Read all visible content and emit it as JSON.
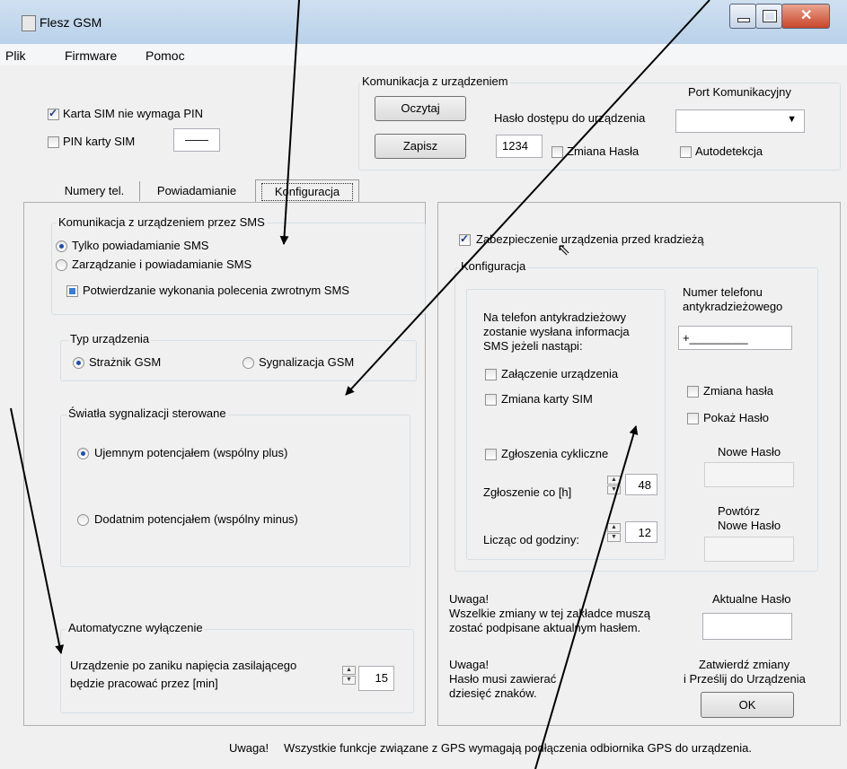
{
  "window": {
    "title": "Flesz GSM"
  },
  "menu": [
    "Plik",
    "Firmware",
    "Pomoc"
  ],
  "sim": {
    "no_pin_label": "Karta SIM nie wymaga PIN",
    "pin_label": "PIN karty SIM",
    "pin_value": "——"
  },
  "comm": {
    "title": "Komunikacja z urządzeniem",
    "read_btn": "Oczytaj",
    "save_btn": "Zapisz",
    "password_label": "Hasło dostępu do urządzenia",
    "password_value": "1234",
    "change_password_label": "Zmiana Hasła",
    "port_label": "Port Komunikacyjny",
    "autodetect_label": "Autodetekcja"
  },
  "tabs": [
    "Numery tel.",
    "Powiadamianie",
    "Konfiguracja"
  ],
  "sms_group": {
    "title": "Komunikacja z urządzeniem przez SMS",
    "option1": "Tylko powiadamianie SMS",
    "option2": "Zarządzanie i powiadamianie SMS",
    "confirm": "Potwierdzanie wykonania polecenia zwrotnym SMS"
  },
  "device_type": {
    "title": "Typ urządzenia",
    "option1": "Strażnik GSM",
    "option2": "Sygnalizacja GSM"
  },
  "lights": {
    "title": "Światła sygnalizacji sterowane",
    "option1": "Ujemnym potencjałem  (wspólny plus)",
    "option2": "Dodatnim potencjałem  (wspólny minus)"
  },
  "auto_off": {
    "title": "Automatyczne wyłączenie",
    "line1": "Urządzenie po zaniku napięcia zasilającego",
    "line2": "będzie pracować przez [min]",
    "value": "15"
  },
  "antitheft": {
    "enable_label": "Zabezpieczenie urządzenia przed kradzieżą",
    "config_title": "Konfiguracja",
    "info_line1": "Na telefon antykradzieżowy",
    "info_line2": "zostanie wysłana informacja",
    "info_line3": "SMS jeżeli nastąpi:",
    "device_on": "Załączenie urządzenia",
    "sim_change": "Zmiana karty SIM",
    "periodic": "Zgłoszenia cykliczne",
    "period_label": "Zgłoszenie co [h]",
    "period_value": "48",
    "from_hour_label": "Licząc od godziny:",
    "from_hour_value": "12",
    "phone_label1": "Numer telefonu",
    "phone_label2": "antykradzieżowego",
    "phone_value": "+_________",
    "change_pw": "Zmiana hasła",
    "show_pw": "Pokaż Hasło",
    "new_pw": "Nowe Hasło",
    "repeat_pw1": "Powtórz",
    "repeat_pw2": "Nowe Hasło"
  },
  "notes": {
    "warn1_title": "Uwaga!",
    "warn1_line1": "Wszelkie zmiany w tej zakładce muszą",
    "warn1_line2": "zostać podpisane aktualnym hasłem.",
    "current_pw": "Aktualne Hasło",
    "warn2_title": "Uwaga!",
    "warn2_line1": "Hasło musi zawierać",
    "warn2_line2": "dziesięć znaków.",
    "confirm_line1": "Zatwierdź zmiany",
    "confirm_line2": "i Prześlij do Urządzenia",
    "ok": "OK"
  },
  "footer": {
    "uwaga": "Uwaga!",
    "text": "Wszystkie funkcje związane z GPS wymagają podłączenia odbiornika GPS do urządzenia."
  }
}
